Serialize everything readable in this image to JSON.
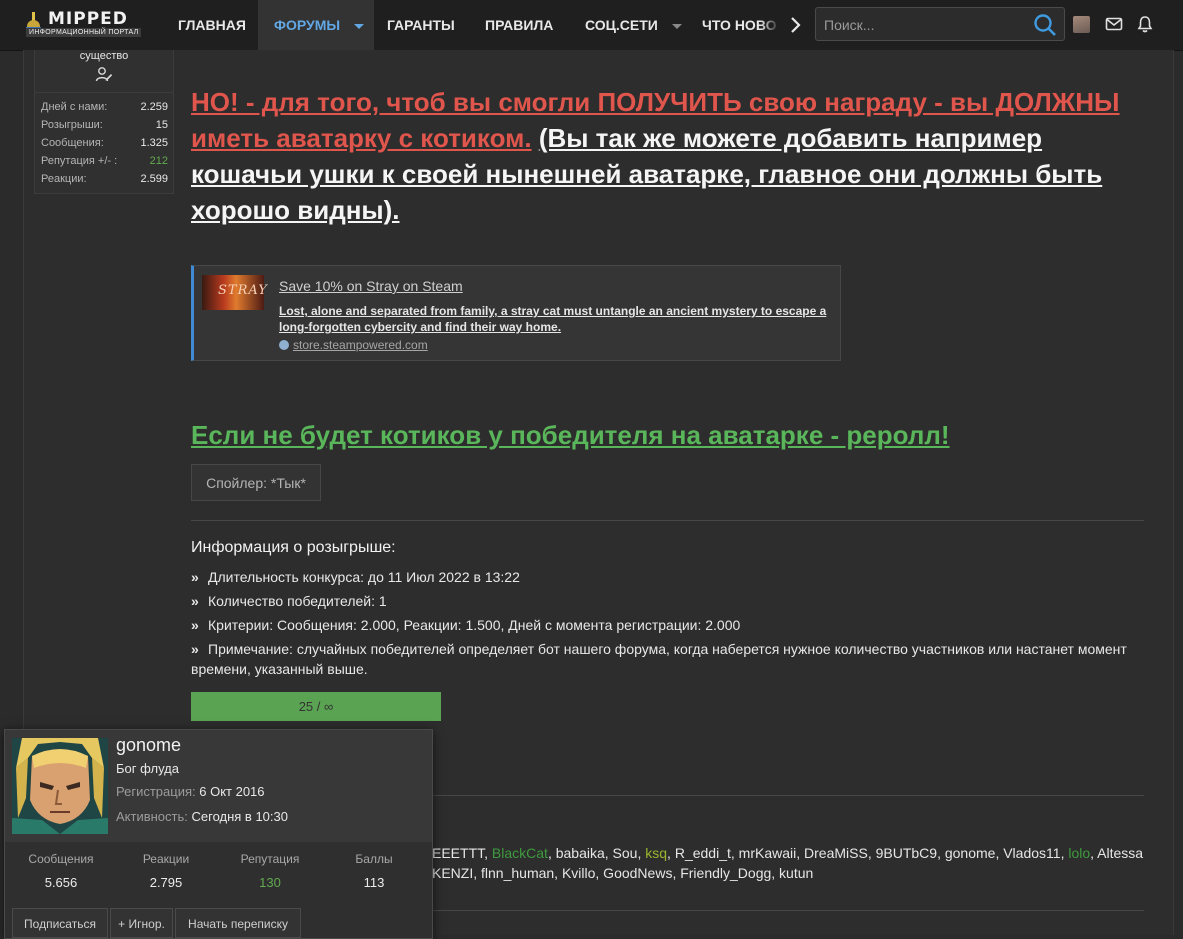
{
  "nav": {
    "logo_name": "MIPPED",
    "logo_tagline": "ИНФОРМАЦИОННЫЙ ПОРТАЛ",
    "tabs": [
      "ГЛАВНАЯ",
      "ФОРУМЫ",
      "ГАРАНТЫ",
      "ПРАВИЛА",
      "СОЦ.СЕТИ",
      "ЧТО НОВОГО"
    ],
    "active_tab": "ФОРУМЫ",
    "search_placeholder": "Поиск...",
    "accent_color": "#62a8e5"
  },
  "author": {
    "role_tail": "существо",
    "stats": [
      {
        "label": "Дней с нами:",
        "value": "2.259"
      },
      {
        "label": "Розыгрыши:",
        "value": "15"
      },
      {
        "label": "Сообщения:",
        "value": "1.325"
      },
      {
        "label": "Репутация +/- :",
        "value": "212"
      },
      {
        "label": "Реакции:",
        "value": "2.599"
      }
    ]
  },
  "post": {
    "warning_red": "НО! - для того, чтоб вы смогли ПОЛУЧИТЬ свою награду - вы ДОЛЖНЫ иметь аватарку с котиком.",
    "warning_white": "(Вы так же можете добавить например кошачьи ушки к своей нынешней аватарке, главное они должны быть хорошо видны).",
    "steam": {
      "thumb_text": "STRAY",
      "title": "Save 10% on Stray on Steam",
      "description": "Lost, alone and separated from family, a stray cat must untangle an ancient mystery to escape a long-forgotten cybercity and find their way home.",
      "host": "store.steampowered.com"
    },
    "reroll": "Если не будет котиков у победителя на аватарке - реролл!",
    "spoiler_label": "Спойлер: *Тык*"
  },
  "giveaway": {
    "title": "Информация о розыгрыше:",
    "items": [
      "Длительность конкурса: до 11 Июл 2022 в 13:22",
      "Количество победителей: 1",
      "Критерии: Сообщения: 2.000, Реакции: 1.500, Дней с момента регистрации: 2.000",
      "Примечание: случайных победителей определяет бот нашего форума, когда наберется нужное количество участников или настанет момент времени, указанный выше."
    ],
    "progress_label": "25 / ∞"
  },
  "participants": {
    "line1": [
      {
        "name": "EEETTT",
        "color": "#e6e6e6"
      },
      {
        "name": "BlackCat",
        "color": "#3e9a3e"
      },
      {
        "name": "babaika",
        "color": "#e6e6e6"
      },
      {
        "name": "Sou",
        "color": "#e6e6e6"
      },
      {
        "name": "ksq",
        "color": "#9ab52e"
      },
      {
        "name": "R_eddi_t",
        "color": "#e6e6e6"
      },
      {
        "name": "mrKawaii",
        "color": "#e6e6e6"
      },
      {
        "name": "DreaMiSS",
        "color": "#e6e6e6"
      },
      {
        "name": "9BUTbC9",
        "color": "#e6e6e6"
      },
      {
        "name": "gonome",
        "color": "#e6e6e6"
      },
      {
        "name": "Vlados11",
        "color": "#e6e6e6"
      },
      {
        "name": "lolo",
        "color": "#3e9a3e"
      },
      {
        "name": "Altessa",
        "color": "#e6e6e6"
      }
    ],
    "line2": "KENZI, flnn_human, Kvillo, GoodNews, Friendly_Dogg, kutun"
  },
  "member_card": {
    "name": "gonome",
    "title": "Бог флуда",
    "reg_label": "Регистрация:",
    "reg_value": "6 Окт 2016",
    "act_label": "Активность:",
    "act_value": "Сегодня в 10:30",
    "stats": [
      {
        "label": "Сообщения",
        "value": "5.656"
      },
      {
        "label": "Реакции",
        "value": "2.795"
      },
      {
        "label": "Репутация",
        "value": "130"
      },
      {
        "label": "Баллы",
        "value": "113"
      }
    ],
    "buttons": [
      "Подписаться",
      "+ Игнор.",
      "Начать переписку"
    ]
  }
}
